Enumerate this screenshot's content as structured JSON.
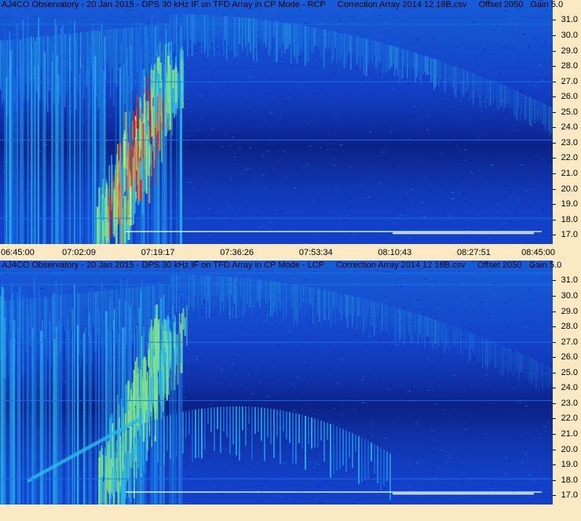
{
  "chart_data": [
    {
      "type": "heatmap",
      "title": "AJ4CO Observatory - 20 Jan 2015 - DPS 30 kHz IF on TFD Array in CP Mode - RCP     Correction Array 2014 12 18B.csv     Offset 2050   Gain 5.0",
      "polarization": "RCP",
      "y_ticks": [
        "31.0",
        "30.0",
        "29.0",
        "28.0",
        "27.0",
        "26.0",
        "25.0",
        "24.0",
        "23.0",
        "22.0",
        "21.0",
        "20.0",
        "19.0",
        "18.0",
        "17.0"
      ],
      "x_ticks": [
        "06:45:00",
        "07:02:09",
        "07:19:17",
        "07:36:26",
        "07:53:34",
        "08:10:43",
        "08:27:51",
        "08:45:00"
      ],
      "ylim": [
        16.4,
        32.3
      ],
      "colormap": [
        "#0a1e80",
        "#1340c8",
        "#1a78e8",
        "#29b8e8",
        "#7fe08c",
        "#e8e040",
        "#f08030",
        "#e02020"
      ]
    },
    {
      "type": "heatmap",
      "title": "AJ4CO Observatory - 20 Jan 2015 - DPS 30 kHz IF on TFD Array in CP Mode - LCP     Correction Array 2014 12 18B.csv     Offset 2050   Gain 5.0",
      "polarization": "LCP",
      "y_ticks": [
        "31.0",
        "30.0",
        "29.0",
        "28.0",
        "27.0",
        "26.0",
        "25.0",
        "24.0",
        "23.0",
        "22.0",
        "21.0",
        "20.0",
        "19.0",
        "18.0",
        "17.0"
      ],
      "x_ticks": [],
      "ylim": [
        16.4,
        32.3
      ],
      "colormap": [
        "#0a1e80",
        "#1340c8",
        "#1a78e8",
        "#29b8e8",
        "#7fe08c",
        "#e8e040",
        "#f08030",
        "#e02020"
      ]
    }
  ]
}
